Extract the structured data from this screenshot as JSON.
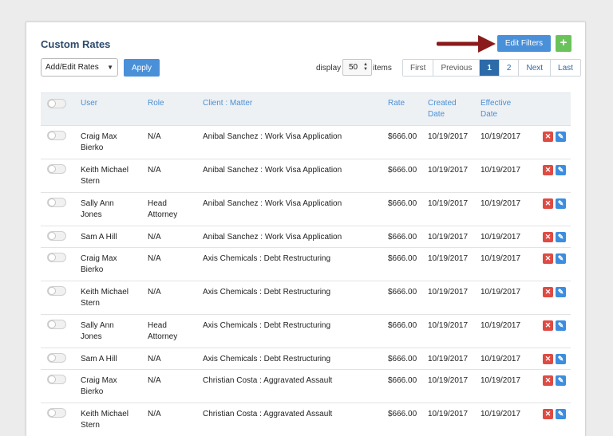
{
  "page": {
    "title": "Custom Rates",
    "edit_filters_label": "Edit Filters",
    "add_label": "+",
    "rates_select": "Add/Edit Rates",
    "apply_label": "Apply",
    "display_label": "display",
    "per_page": "50",
    "items_label": "items"
  },
  "pagination": [
    "First",
    "Previous",
    "1",
    "2",
    "Next",
    "Last"
  ],
  "colors": {
    "primary": "#4a90d9",
    "add": "#6ac35a",
    "delete": "#de4b43",
    "edit": "#3c8ddf",
    "arrow": "#8b1a1a"
  },
  "table": {
    "headers": {
      "user": "User",
      "role": "Role",
      "client_matter": "Client : Matter",
      "rate": "Rate",
      "created": "Created Date",
      "effective": "Effective Date"
    },
    "rows": [
      {
        "user": "Craig Max Bierko",
        "role": "N/A",
        "matter": "Anibal Sanchez : Work Visa Application",
        "rate": "$666.00",
        "created": "10/19/2017",
        "effective": "10/19/2017"
      },
      {
        "user": "Keith Michael Stern",
        "role": "N/A",
        "matter": "Anibal Sanchez : Work Visa Application",
        "rate": "$666.00",
        "created": "10/19/2017",
        "effective": "10/19/2017"
      },
      {
        "user": "Sally Ann Jones",
        "role": "Head Attorney",
        "matter": "Anibal Sanchez : Work Visa Application",
        "rate": "$666.00",
        "created": "10/19/2017",
        "effective": "10/19/2017"
      },
      {
        "user": "Sam A Hill",
        "role": "N/A",
        "matter": "Anibal Sanchez : Work Visa Application",
        "rate": "$666.00",
        "created": "10/19/2017",
        "effective": "10/19/2017"
      },
      {
        "user": "Craig Max Bierko",
        "role": "N/A",
        "matter": "Axis Chemicals : Debt Restructuring",
        "rate": "$666.00",
        "created": "10/19/2017",
        "effective": "10/19/2017"
      },
      {
        "user": "Keith Michael Stern",
        "role": "N/A",
        "matter": "Axis Chemicals : Debt Restructuring",
        "rate": "$666.00",
        "created": "10/19/2017",
        "effective": "10/19/2017"
      },
      {
        "user": "Sally Ann Jones",
        "role": "Head Attorney",
        "matter": "Axis Chemicals : Debt Restructuring",
        "rate": "$666.00",
        "created": "10/19/2017",
        "effective": "10/19/2017"
      },
      {
        "user": "Sam A Hill",
        "role": "N/A",
        "matter": "Axis Chemicals : Debt Restructuring",
        "rate": "$666.00",
        "created": "10/19/2017",
        "effective": "10/19/2017"
      },
      {
        "user": "Craig Max Bierko",
        "role": "N/A",
        "matter": "Christian Costa : Aggravated Assault",
        "rate": "$666.00",
        "created": "10/19/2017",
        "effective": "10/19/2017"
      },
      {
        "user": "Keith Michael Stern",
        "role": "N/A",
        "matter": "Christian Costa : Aggravated Assault",
        "rate": "$666.00",
        "created": "10/19/2017",
        "effective": "10/19/2017"
      }
    ]
  },
  "icons": {
    "delete": "close-icon",
    "edit": "pencil-icon",
    "annotation": "arrow-icon"
  }
}
